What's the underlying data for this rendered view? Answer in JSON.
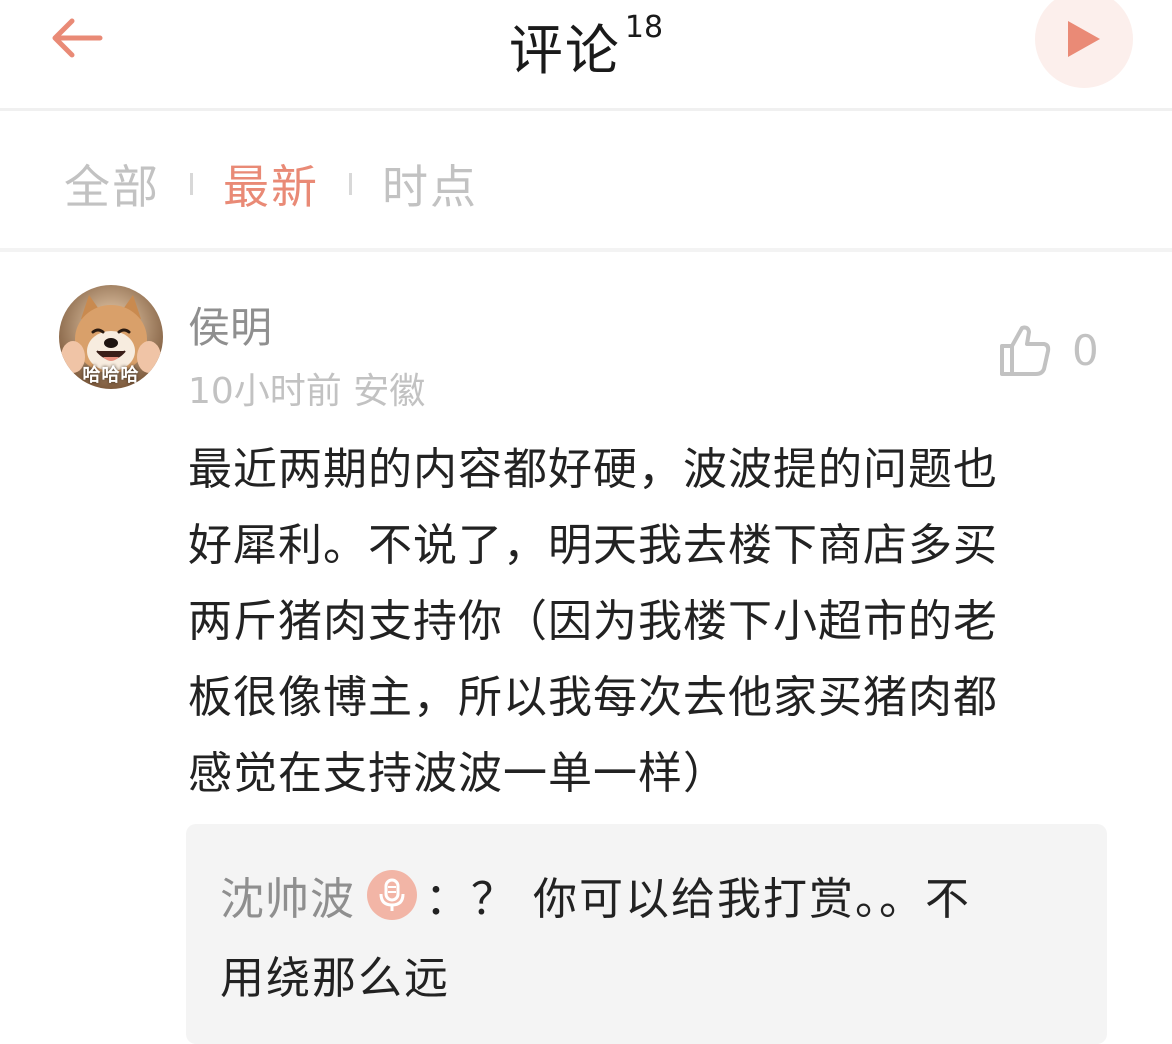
{
  "header": {
    "title": "评论",
    "count": "18"
  },
  "tabs": [
    {
      "label": "全部",
      "active": false
    },
    {
      "label": "最新",
      "active": true
    },
    {
      "label": "时点",
      "active": false
    }
  ],
  "comment": {
    "avatar_caption": "哈哈哈",
    "username": "侯明",
    "time": "10小时前",
    "location": "安徽",
    "like_count": "0",
    "text_lines": [
      "最近两期的内容都好硬，波波提的问题也",
      "好犀利。不说了，明天我去楼下商店多买",
      "两斤猪肉支持你（因为我楼下小超市的老",
      "板很像博主，所以我每次去他家买猪肉都",
      "感觉在支持波波一单一样）"
    ],
    "reply": {
      "author": "沈帅波",
      "line1": "：？ 你可以给我打赏。。不",
      "line2": "用绕那么远"
    }
  },
  "colors": {
    "accent": "#e98a76",
    "muted": "#c2c2c2",
    "reply_bg": "#f4f4f4",
    "play_bg": "#fcefec"
  },
  "icons": {
    "back": "arrow-left-icon",
    "play": "play-icon",
    "like": "thumbs-up-icon",
    "mic": "microphone-icon"
  }
}
